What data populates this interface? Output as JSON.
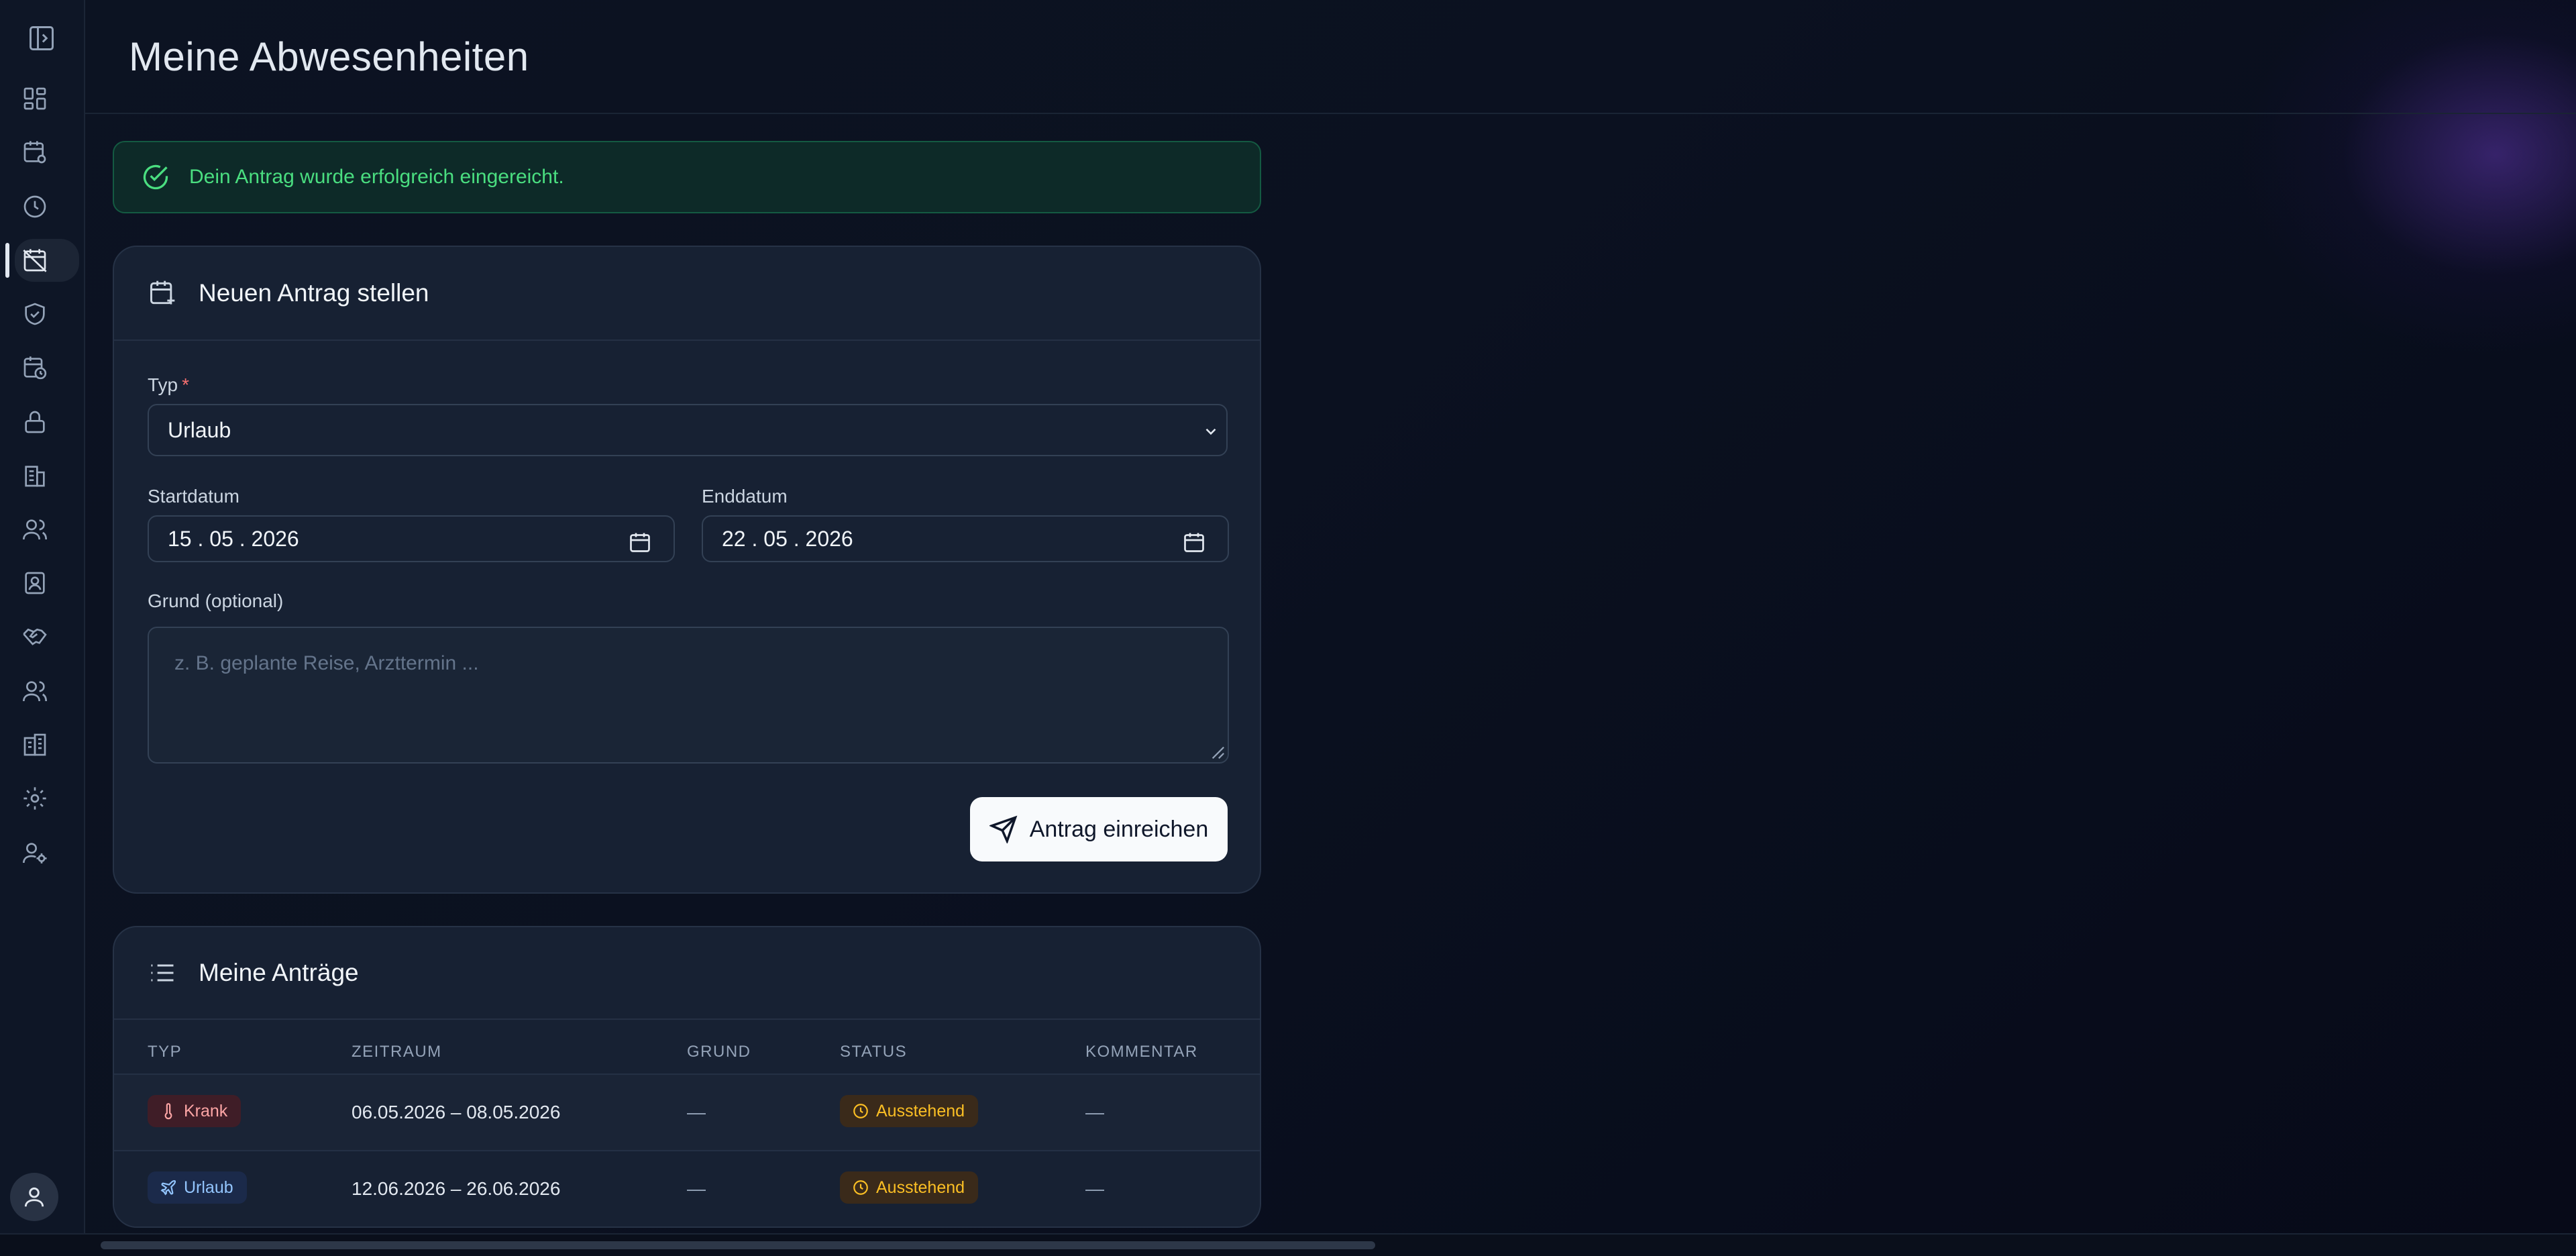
{
  "header": {
    "title": "Meine Abwesenheiten"
  },
  "alert": {
    "message": "Dein Antrag wurde erfolgreich eingereicht."
  },
  "sidebar": {
    "items": [
      {
        "icon": "dashboard-icon"
      },
      {
        "icon": "calendar-settings-icon"
      },
      {
        "icon": "clock-icon"
      },
      {
        "icon": "calendar-off-icon",
        "active": true
      },
      {
        "icon": "shield-check-icon"
      },
      {
        "icon": "calendar-clock-icon"
      },
      {
        "icon": "lock-icon"
      },
      {
        "icon": "building-icon"
      },
      {
        "icon": "users-icon"
      },
      {
        "icon": "contact-card-icon"
      },
      {
        "icon": "handshake-icon"
      },
      {
        "icon": "users-group-icon"
      },
      {
        "icon": "buildings-icon"
      },
      {
        "icon": "gear-icon"
      },
      {
        "icon": "user-cog-icon"
      }
    ]
  },
  "form": {
    "title": "Neuen Antrag stellen",
    "type_label": "Typ",
    "required_mark": "*",
    "type_value": "Urlaub",
    "start_label": "Startdatum",
    "start_value": "15 . 05 . 2026",
    "end_label": "Enddatum",
    "end_value": "22 . 05 . 2026",
    "reason_label": "Grund (optional)",
    "reason_placeholder": "z. B. geplante Reise, Arzttermin ...",
    "submit_label": "Antrag einreichen"
  },
  "requests": {
    "title": "Meine Anträge",
    "columns": [
      "TYP",
      "ZEITRAUM",
      "GRUND",
      "STATUS",
      "KOMMENTAR"
    ],
    "rows": [
      {
        "type": "Krank",
        "period": "06.05.2026  –  08.05.2026",
        "reason": "—",
        "status": "Ausstehend",
        "comment": "—"
      },
      {
        "type": "Urlaub",
        "period": "12.06.2026  –  26.06.2026",
        "reason": "—",
        "status": "Ausstehend",
        "comment": "—"
      }
    ]
  },
  "colors": {
    "success": "#4ade80",
    "pending": "#fbbf24",
    "sick": "#fca5a5",
    "vacation": "#93c5fd"
  }
}
